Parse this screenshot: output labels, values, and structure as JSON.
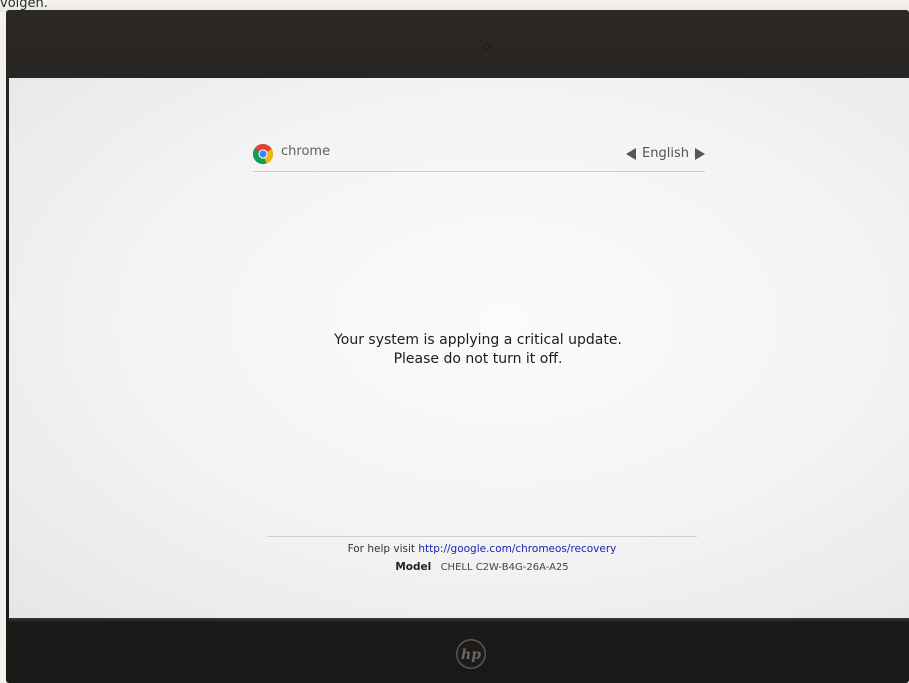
{
  "photo_caption": "volgen.",
  "header": {
    "brand": "chrome",
    "language": "English"
  },
  "message": {
    "line1": "Your system is applying a critical update.",
    "line2": "Please do not turn it off."
  },
  "footer": {
    "help_prefix": "For help visit",
    "help_url": "http://google.com/chromeos/recovery",
    "model_label": "Model",
    "model_value": "CHELL C2W-B4G-26A-A25"
  },
  "device": {
    "manufacturer_logo": "hp"
  },
  "colors": {
    "link": "#1a22b8",
    "screen_bg": "#f7f7f7",
    "bezel": "#1f1d1b"
  }
}
